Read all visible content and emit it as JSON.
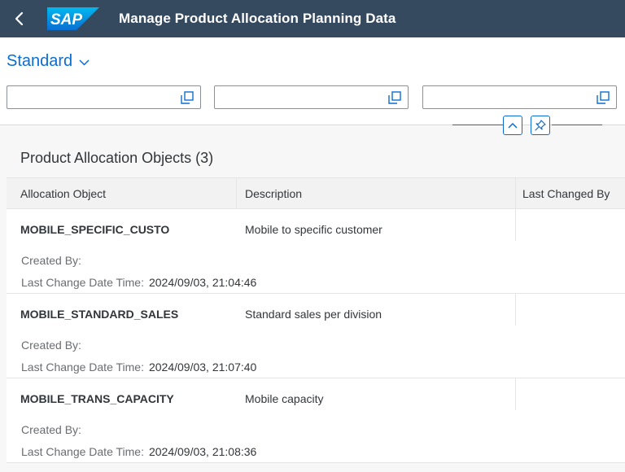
{
  "shell": {
    "logo_text": "SAP",
    "title": "Manage Product Allocation Planning Data"
  },
  "header": {
    "variant": "Standard"
  },
  "table": {
    "title": "Product Allocation Objects (3)",
    "columns": [
      "Allocation Object",
      "Description",
      "Last Changed By"
    ],
    "created_by_label": "Created By:",
    "last_change_label": "Last Change Date Time:",
    "rows": [
      {
        "object": "MOBILE_SPECIFIC_CUSTO",
        "description": "Mobile to specific customer",
        "last_change": "2024/09/03, 21:04:46"
      },
      {
        "object": "MOBILE_STANDARD_SALES",
        "description": "Standard sales per division",
        "last_change": "2024/09/03, 21:07:40"
      },
      {
        "object": "MOBILE_TRANS_CAPACITY",
        "description": "Mobile capacity",
        "last_change": "2024/09/03, 21:08:36"
      }
    ]
  },
  "colors": {
    "shell_bg": "#354a5f",
    "link": "#0a6ed1",
    "sap_blue": "#0a6ed1"
  },
  "icons": {
    "back": "back-icon",
    "variant": "chevron-down-icon",
    "value_help": "value-help-icon",
    "collapse": "chevron-up-icon",
    "pin": "pin-icon"
  }
}
